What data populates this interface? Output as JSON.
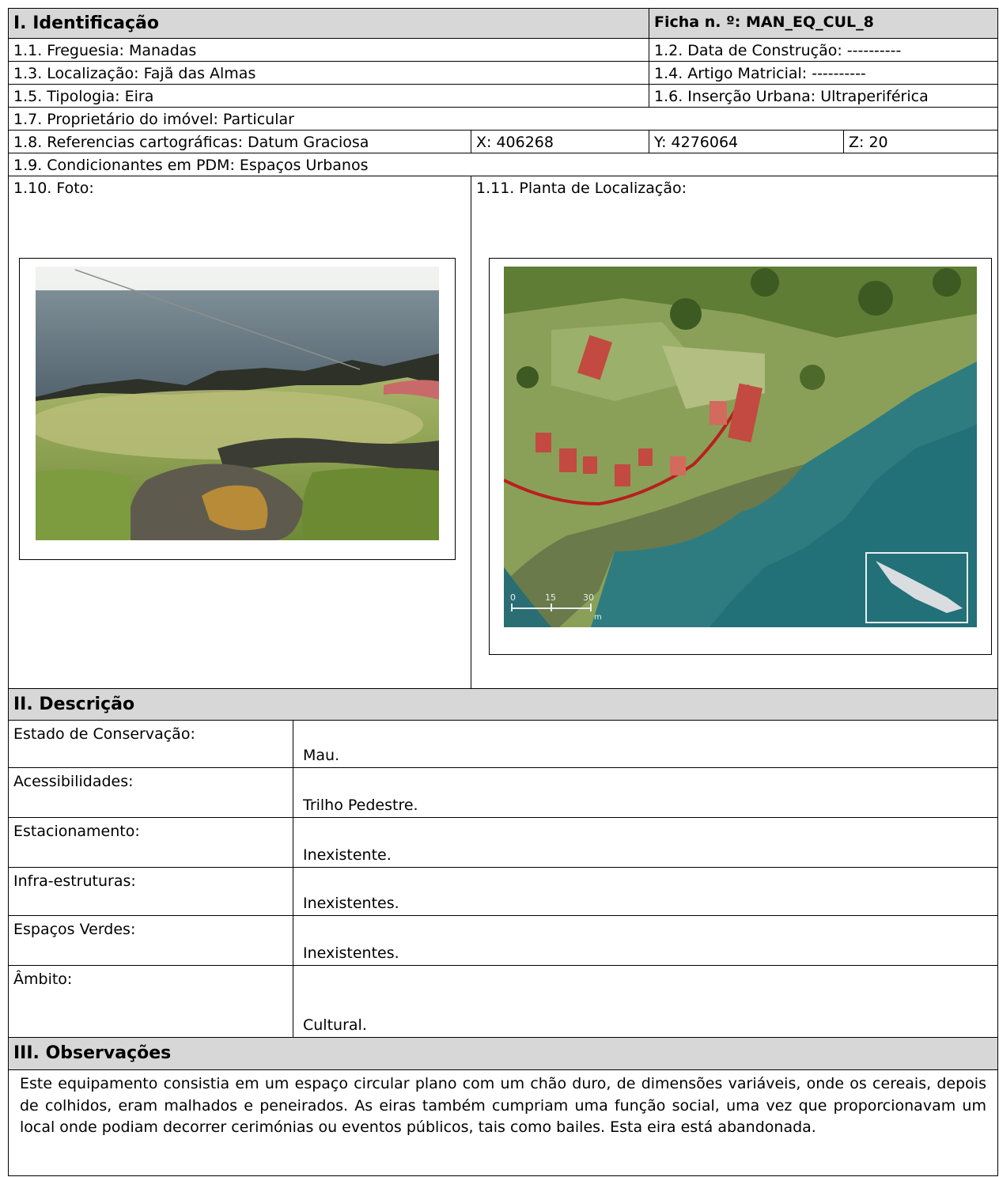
{
  "section1": {
    "title": "I. Identificação",
    "ficha": "Ficha n. º: MAN_EQ_CUL_8",
    "freguesia": "1.1. Freguesia: Manadas",
    "data_construcao": "1.2. Data de Construção: ----------",
    "localizacao": "1.3. Localização: Fajã das Almas",
    "artigo_matricial": "1.4. Artigo Matricial: ----------",
    "tipologia": "1.5. Tipologia: Eira",
    "insercao_urbana": "1.6. Inserção Urbana: Ultraperiférica",
    "proprietario": "1.7. Proprietário do imóvel: Particular",
    "referencias": "1.8. Referencias cartográficas: Datum Graciosa",
    "x": "X: 406268",
    "y": "Y: 4276064",
    "z": "Z: 20",
    "condicionantes": "1.9. Condicionantes em PDM: Espaços Urbanos",
    "foto_label": "1.10. Foto:",
    "planta_label": "1.11. Planta de Localização:",
    "scale_labels": [
      "0",
      "15",
      "30"
    ],
    "scale_unit": "m"
  },
  "section2": {
    "title": "II. Descrição",
    "rows": [
      {
        "label": "Estado de Conservação:",
        "value": "Mau."
      },
      {
        "label": "Acessibilidades:",
        "value": "Trilho Pedestre."
      },
      {
        "label": "Estacionamento:",
        "value": "Inexistente."
      },
      {
        "label": "Infra-estruturas:",
        "value": "Inexistentes."
      },
      {
        "label": "Espaços Verdes:",
        "value": "Inexistentes."
      },
      {
        "label": "Âmbito:",
        "value": "Cultural."
      }
    ]
  },
  "section3": {
    "title": "III. Observações",
    "text": "Este equipamento consistia em um espaço circular plano com um chão duro, de dimensões variáveis, onde os cereais, depois de colhidos, eram malhados e peneirados. As eiras também cumpriam uma função social, uma vez que proporcionavam um local onde podiam decorrer cerimónias ou eventos públicos, tais como bailes. Esta eira está abandonada."
  },
  "colors": {
    "header_gray": "#d7d7d7",
    "sea": "#3d7f8a",
    "grass": "#7f9a4a",
    "roof": "#c24a40",
    "road": "#b8201e"
  }
}
